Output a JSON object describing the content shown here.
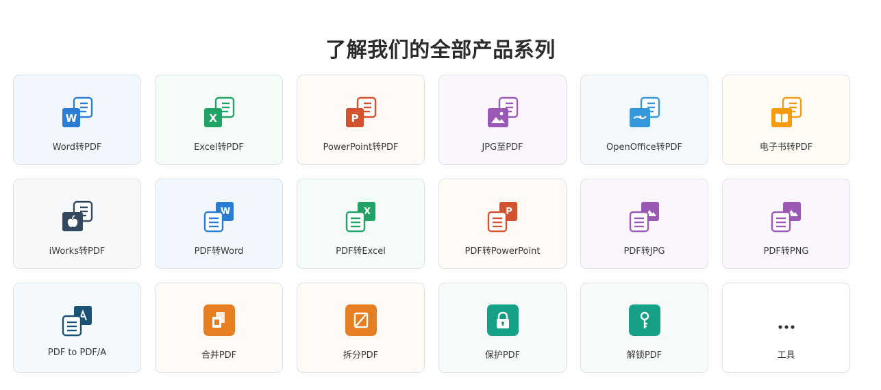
{
  "page": {
    "title": "了解我们的全部产品系列"
  },
  "colors": {
    "word": "#2b7cd3",
    "excel": "#21a366",
    "powerpoint": "#d35230",
    "jpg": "#9b59b6",
    "openoffice": "#3498db",
    "ebook": "#f39c12",
    "iworks": "#34495e",
    "pdfa": "#1a5276",
    "merge": "#e67e22",
    "protect": "#16a085"
  },
  "tools": [
    {
      "label": "Word转PDF",
      "icon": "word-to-pdf-icon"
    },
    {
      "label": "Excel转PDF",
      "icon": "excel-to-pdf-icon"
    },
    {
      "label": "PowerPoint转PDF",
      "icon": "powerpoint-to-pdf-icon"
    },
    {
      "label": "JPG至PDF",
      "icon": "jpg-to-pdf-icon"
    },
    {
      "label": "OpenOffice转PDF",
      "icon": "openoffice-to-pdf-icon"
    },
    {
      "label": "电子书转PDF",
      "icon": "ebook-to-pdf-icon"
    },
    {
      "label": "iWorks转PDF",
      "icon": "iworks-to-pdf-icon"
    },
    {
      "label": "PDF转Word",
      "icon": "pdf-to-word-icon"
    },
    {
      "label": "PDF转Excel",
      "icon": "pdf-to-excel-icon"
    },
    {
      "label": "PDF转PowerPoint",
      "icon": "pdf-to-powerpoint-icon"
    },
    {
      "label": "PDF转JPG",
      "icon": "pdf-to-jpg-icon"
    },
    {
      "label": "PDF转PNG",
      "icon": "pdf-to-png-icon"
    },
    {
      "label": "PDF to PDF/A",
      "icon": "pdf-to-pdfa-icon"
    },
    {
      "label": "合并PDF",
      "icon": "merge-pdf-icon"
    },
    {
      "label": "拆分PDF",
      "icon": "split-pdf-icon"
    },
    {
      "label": "保护PDF",
      "icon": "protect-pdf-icon"
    },
    {
      "label": "解锁PDF",
      "icon": "unlock-pdf-icon"
    },
    {
      "label": "工具",
      "icon": "more-dots-icon"
    }
  ],
  "glyphs": {
    "word": "W",
    "excel": "X",
    "powerpoint": "P",
    "more": "•••"
  }
}
